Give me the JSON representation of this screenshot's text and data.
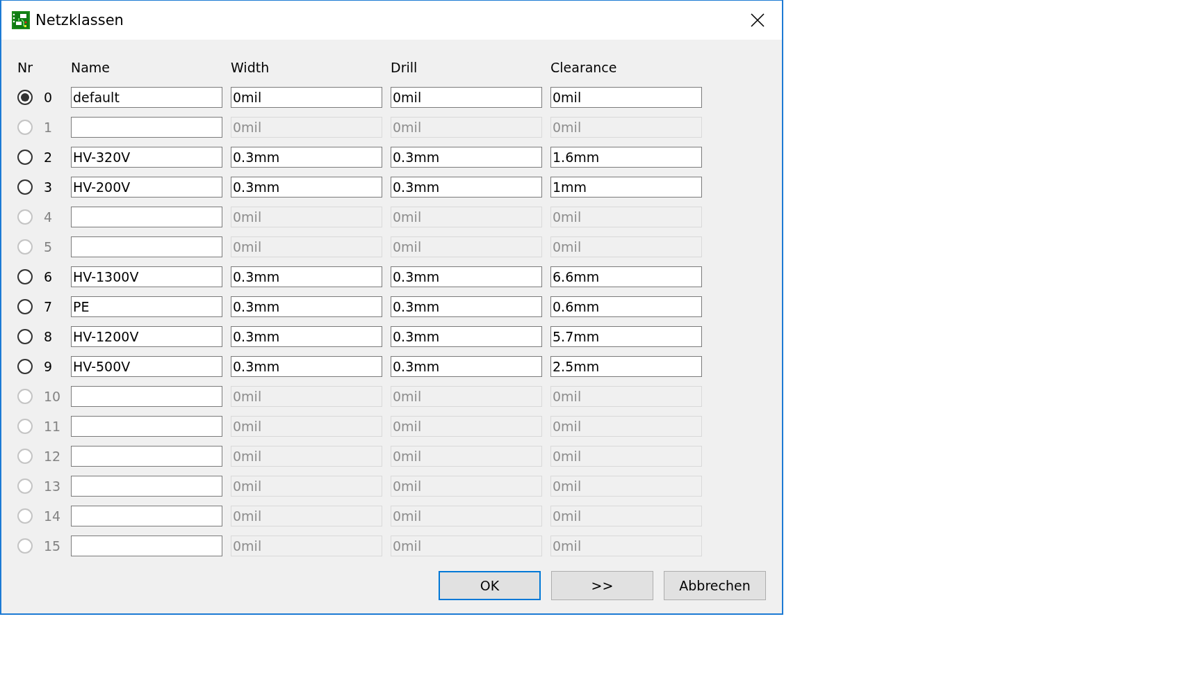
{
  "window": {
    "title": "Netzklassen"
  },
  "columns": [
    "Nr",
    "Name",
    "Width",
    "Drill",
    "Clearance"
  ],
  "rows": [
    {
      "number": "0",
      "selected": true,
      "disabled": false,
      "name": "default",
      "width": "0mil",
      "drill": "0mil",
      "clearance": "0mil"
    },
    {
      "number": "1",
      "selected": false,
      "disabled": true,
      "width": "0mil",
      "drill": "0mil",
      "clearance": "0mil"
    },
    {
      "number": "2",
      "selected": false,
      "disabled": false,
      "name": "HV-320V",
      "width": "0.3mm",
      "drill": "0.3mm",
      "clearance": "1.6mm"
    },
    {
      "number": "3",
      "selected": false,
      "disabled": false,
      "name": "HV-200V",
      "width": "0.3mm",
      "drill": "0.3mm",
      "clearance": "1mm"
    },
    {
      "number": "4",
      "selected": false,
      "disabled": true,
      "width": "0mil",
      "drill": "0mil",
      "clearance": "0mil"
    },
    {
      "number": "5",
      "selected": false,
      "disabled": true,
      "width": "0mil",
      "drill": "0mil",
      "clearance": "0mil"
    },
    {
      "number": "6",
      "selected": false,
      "disabled": false,
      "name": "HV-1300V",
      "width": "0.3mm",
      "drill": "0.3mm",
      "clearance": "6.6mm"
    },
    {
      "number": "7",
      "selected": false,
      "disabled": false,
      "name": "PE",
      "width": "0.3mm",
      "drill": "0.3mm",
      "clearance": "0.6mm"
    },
    {
      "number": "8",
      "selected": false,
      "disabled": false,
      "name": "HV-1200V",
      "width": "0.3mm",
      "drill": "0.3mm",
      "clearance": "5.7mm"
    },
    {
      "number": "9",
      "selected": false,
      "disabled": false,
      "name": "HV-500V",
      "width": "0.3mm",
      "drill": "0.3mm",
      "clearance": "2.5mm"
    },
    {
      "number": "10",
      "selected": false,
      "disabled": true,
      "width": "0mil",
      "drill": "0mil",
      "clearance": "0mil"
    },
    {
      "number": "11",
      "selected": false,
      "disabled": true,
      "width": "0mil",
      "drill": "0mil",
      "clearance": "0mil"
    },
    {
      "number": "12",
      "selected": false,
      "disabled": true,
      "width": "0mil",
      "drill": "0mil",
      "clearance": "0mil"
    },
    {
      "number": "13",
      "selected": false,
      "disabled": true,
      "width": "0mil",
      "drill": "0mil",
      "clearance": "0mil"
    },
    {
      "number": "14",
      "selected": false,
      "disabled": true,
      "width": "0mil",
      "drill": "0mil",
      "clearance": "0mil"
    },
    {
      "number": "15",
      "selected": false,
      "disabled": true,
      "width": "0mil",
      "drill": "0mil",
      "clearance": "0mil"
    }
  ],
  "buttons": [
    {
      "label": "OK",
      "default": true
    },
    {
      "label": ">>",
      "default": false
    },
    {
      "label": "Abbrechen",
      "default": false
    }
  ]
}
